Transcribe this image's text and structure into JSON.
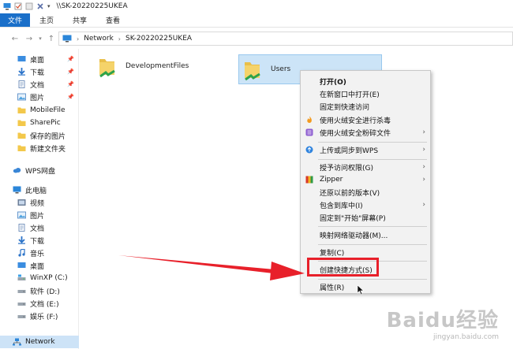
{
  "window": {
    "title": "\\\\SK-20220225UKEA"
  },
  "ribbon": {
    "tabs": [
      "文件",
      "主页",
      "共享",
      "查看"
    ]
  },
  "address": {
    "crumbs": [
      "Network",
      "SK-20220225UKEA"
    ]
  },
  "sidebar": {
    "items": [
      {
        "label": "桌面",
        "icon": "desktop-icon",
        "pinned": true
      },
      {
        "label": "下载",
        "icon": "download-icon",
        "pinned": true
      },
      {
        "label": "文档",
        "icon": "document-icon",
        "pinned": true
      },
      {
        "label": "图片",
        "icon": "picture-icon",
        "pinned": true
      },
      {
        "label": "MobileFile",
        "icon": "folder-icon",
        "pinned": false
      },
      {
        "label": "SharePic",
        "icon": "folder-icon",
        "pinned": false
      },
      {
        "label": "保存的图片",
        "icon": "folder-icon",
        "pinned": false
      },
      {
        "label": "新建文件夹",
        "icon": "folder-icon",
        "pinned": false
      },
      {
        "label": "WPS网盘",
        "icon": "cloud-icon",
        "pinned": false
      },
      {
        "label": "此电脑",
        "icon": "computer-icon",
        "pinned": false
      },
      {
        "label": "视频",
        "icon": "video-icon",
        "pinned": false
      },
      {
        "label": "图片",
        "icon": "picture-icon",
        "pinned": false
      },
      {
        "label": "文档",
        "icon": "document-icon",
        "pinned": false
      },
      {
        "label": "下载",
        "icon": "download-icon",
        "pinned": false
      },
      {
        "label": "音乐",
        "icon": "music-icon",
        "pinned": false
      },
      {
        "label": "桌面",
        "icon": "desktop-icon",
        "pinned": false
      },
      {
        "label": "WinXP (C:)",
        "icon": "drive-icon",
        "pinned": false
      },
      {
        "label": "软件 (D:)",
        "icon": "drive-icon",
        "pinned": false
      },
      {
        "label": "文档 (E:)",
        "icon": "drive-icon",
        "pinned": false
      },
      {
        "label": "娱乐 (F:)",
        "icon": "drive-icon",
        "pinned": false
      },
      {
        "label": "Network",
        "icon": "network-icon",
        "pinned": false
      }
    ]
  },
  "content": {
    "folders": [
      {
        "name": "DevelopmentFiles",
        "icon": "shared-folder-icon"
      },
      {
        "name": "Users",
        "icon": "shared-folder-icon"
      }
    ]
  },
  "context_menu": {
    "items": [
      {
        "label": "打开(O)",
        "bold": true
      },
      {
        "label": "在新窗口中打开(E)"
      },
      {
        "label": "固定到快速访问"
      },
      {
        "label": "使用火绒安全进行杀毒",
        "icon": "huorong-icon"
      },
      {
        "label": "使用火绒安全粉碎文件",
        "icon": "shredder-icon",
        "arrow": "›"
      },
      {
        "label": "上传或同步到WPS",
        "icon": "wps-cloud-icon",
        "arrow": "›"
      },
      {
        "label": "授予访问权限(G)",
        "arrow": "›"
      },
      {
        "label": "Zipper",
        "icon": "zipper-icon",
        "arrow": "›"
      },
      {
        "label": "还原以前的版本(V)"
      },
      {
        "label": "包含到库中(I)",
        "arrow": "›"
      },
      {
        "label": "固定到\"开始\"屏幕(P)"
      },
      {
        "label": "映射网络驱动器(M)..."
      },
      {
        "label": "复制(C)"
      },
      {
        "label": "创建快捷方式(S)"
      },
      {
        "label": "属性(R)"
      }
    ]
  },
  "watermark": {
    "main": "Baidu经验",
    "sub": "jingyan.baidu.com"
  },
  "colors": {
    "accent": "#1a6fc9",
    "selection": "#cce4f7",
    "highlight": "#e8202a"
  }
}
